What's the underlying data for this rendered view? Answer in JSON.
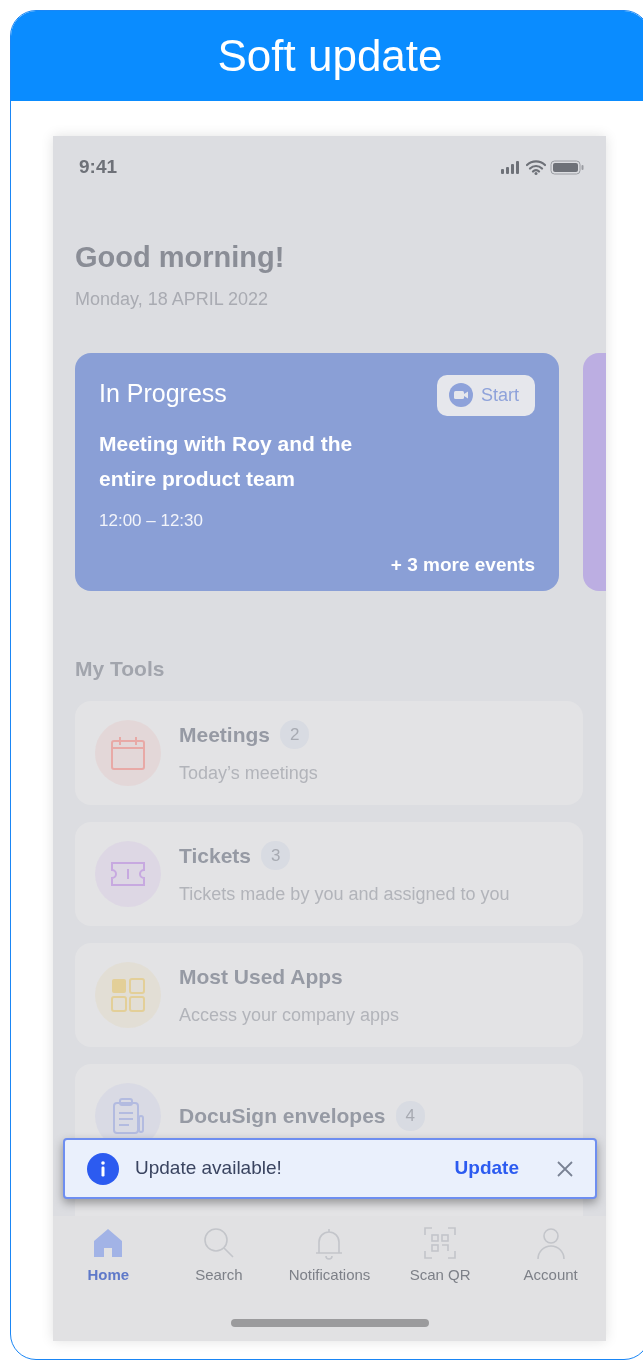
{
  "header": {
    "title": "Soft update"
  },
  "status_bar": {
    "time": "9:41"
  },
  "greeting": "Good morning!",
  "date": "Monday, 18 APRIL 2022",
  "event_card": {
    "status": "In Progress",
    "button": "Start",
    "title": "Meeting with Roy and the entire product team",
    "time": "12:00 – 12:30",
    "more": "+ 3 more events"
  },
  "tools": {
    "title": "My Tools",
    "items": [
      {
        "kind": "calendar",
        "name": "Meetings",
        "count": "2",
        "description": "Today’s meetings",
        "color": "#e8a9a6"
      },
      {
        "kind": "ticket",
        "name": "Tickets",
        "count": "3",
        "description": "Tickets made by you and assigned to you",
        "color": "#c7a9e0"
      },
      {
        "kind": "apps",
        "name": "Most Used Apps",
        "description": "Access your company apps",
        "color": "#e3cf98"
      },
      {
        "kind": "clipboard",
        "name": "DocuSign envelopes",
        "count": "4",
        "color": "#b3bbe0"
      }
    ]
  },
  "banner": {
    "message": "Update available!",
    "action": "Update"
  },
  "tabs": [
    {
      "kind": "home",
      "label": "Home",
      "selected": true
    },
    {
      "kind": "search",
      "label": "Search",
      "selected": false
    },
    {
      "kind": "bell",
      "label": "Notifications",
      "selected": false
    },
    {
      "kind": "qr",
      "label": "Scan QR",
      "selected": false
    },
    {
      "kind": "account",
      "label": "Account",
      "selected": false
    }
  ]
}
